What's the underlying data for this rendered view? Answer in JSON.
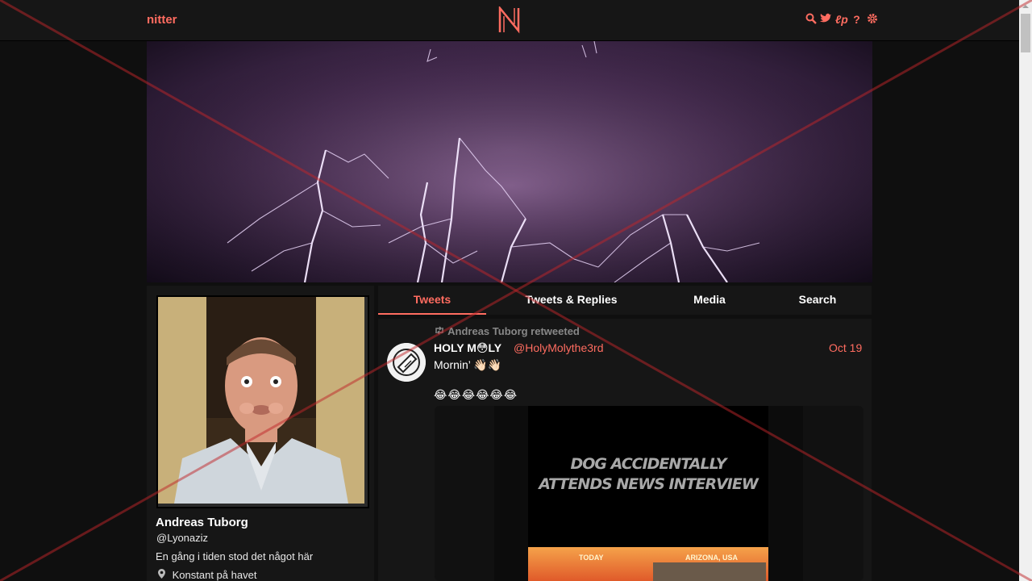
{
  "nav": {
    "brand": "nitter",
    "icons": [
      "search-icon",
      "twitter-icon",
      "rss-icon",
      "help-icon",
      "settings-icon"
    ]
  },
  "profile": {
    "name": "Andreas Tuborg",
    "handle": "@Lyonaziz",
    "bio": "En gång i tiden stod det något här",
    "location": "Konstant på havet"
  },
  "tabs": [
    {
      "label": "Tweets",
      "active": true
    },
    {
      "label": "Tweets & Replies",
      "active": false
    },
    {
      "label": "Media",
      "active": false
    },
    {
      "label": "Search",
      "active": false
    }
  ],
  "tweet": {
    "retweet_text": "Andreas Tuborg retweeted",
    "author_name": "HOLY M😳LY",
    "author_handle": "@HolyMolythe3rd",
    "date": "Oct 19",
    "text_line1": "Mornin’ 👋🏻👋🏻",
    "text_line2": "😂😂😂😂😂😂",
    "media": {
      "caption_line1": "DOG ACCIDENTALLY",
      "caption_line2": "ATTENDS NEWS INTERVIEW",
      "news_left": "TODAY",
      "news_right": "ARIZONA, USA"
    }
  },
  "colors": {
    "accent": "#ff6c60",
    "background": "#0f0f0f",
    "panel": "#161616"
  }
}
